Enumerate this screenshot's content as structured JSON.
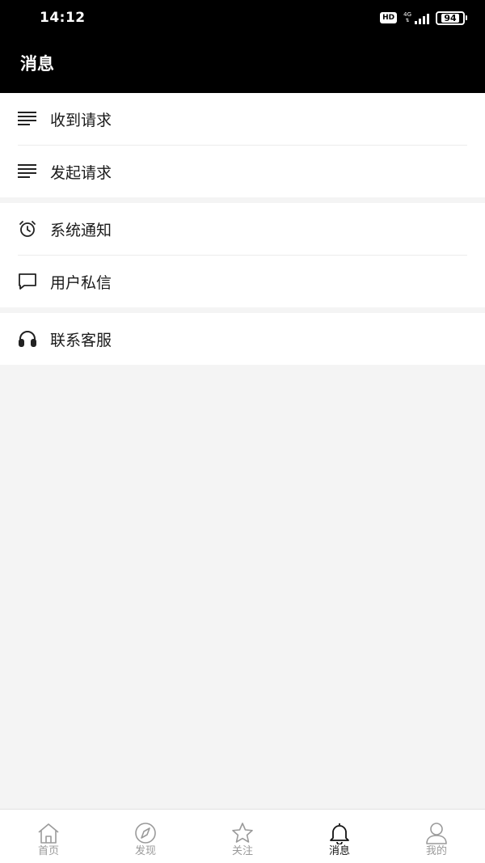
{
  "status_bar": {
    "time": "14:12",
    "hd": "HD",
    "network": "4G",
    "battery": "94"
  },
  "header": {
    "title": "消息"
  },
  "menu": {
    "group1": [
      {
        "label": "收到请求",
        "icon": "list-icon"
      },
      {
        "label": "发起请求",
        "icon": "list-icon"
      }
    ],
    "group2": [
      {
        "label": "系统通知",
        "icon": "alarm-clock-icon"
      },
      {
        "label": "用户私信",
        "icon": "chat-bubble-icon"
      }
    ],
    "group3": [
      {
        "label": "联系客服",
        "icon": "headphones-icon"
      }
    ]
  },
  "bottom_nav": {
    "items": [
      {
        "label": "首页",
        "icon": "home-icon",
        "active": false
      },
      {
        "label": "发现",
        "icon": "compass-icon",
        "active": false
      },
      {
        "label": "关注",
        "icon": "star-icon",
        "active": false
      },
      {
        "label": "消息",
        "icon": "bell-icon",
        "active": true
      },
      {
        "label": "我的",
        "icon": "user-icon",
        "active": false
      }
    ]
  },
  "colors": {
    "header_bg": "#000000",
    "page_bg": "#f4f4f4",
    "active_nav": "#111111",
    "inactive_nav": "#9a9a9a"
  }
}
